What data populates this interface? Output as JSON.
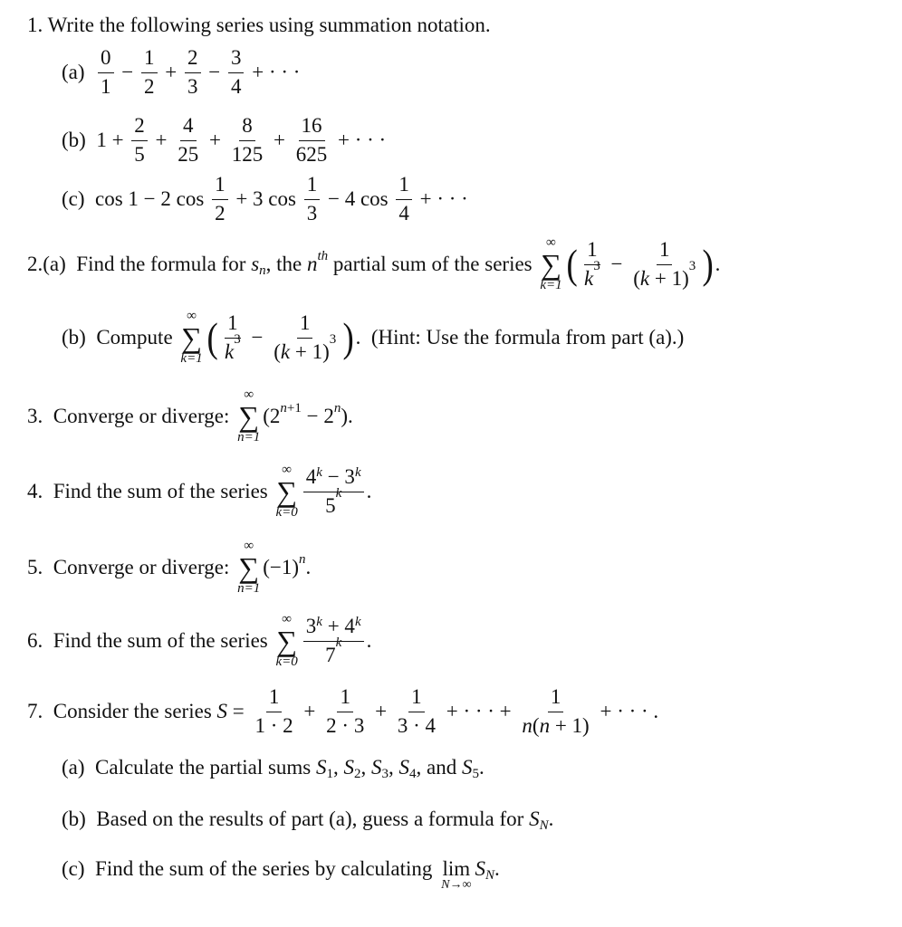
{
  "document": {
    "lines": [
      {
        "tokens": [
          [
            "t",
            "1. Write the following series using summation notation."
          ]
        ]
      },
      {
        "tokens": [
          [
            "t",
            "(a)  "
          ],
          [
            "f",
            [
              [
                "t",
                "0"
              ]
            ],
            [
              [
                "t",
                "1"
              ]
            ]
          ],
          [
            "t",
            " − "
          ],
          [
            "f",
            [
              [
                "t",
                "1"
              ]
            ],
            [
              [
                "t",
                "2"
              ]
            ]
          ],
          [
            "t",
            " + "
          ],
          [
            "f",
            [
              [
                "t",
                "2"
              ]
            ],
            [
              [
                "t",
                "3"
              ]
            ]
          ],
          [
            "t",
            " − "
          ],
          [
            "f",
            [
              [
                "t",
                "3"
              ]
            ],
            [
              [
                "t",
                "4"
              ]
            ]
          ],
          [
            "t",
            " + · · ·"
          ]
        ]
      },
      {
        "tokens": [
          [
            "t",
            "(b)  1 + "
          ],
          [
            "f",
            [
              [
                "t",
                "2"
              ]
            ],
            [
              [
                "t",
                "5"
              ]
            ]
          ],
          [
            "t",
            " + "
          ],
          [
            "f",
            [
              [
                "t",
                "4"
              ]
            ],
            [
              [
                "t",
                "25"
              ]
            ]
          ],
          [
            "t",
            " + "
          ],
          [
            "f",
            [
              [
                "t",
                "8"
              ]
            ],
            [
              [
                "t",
                "125"
              ]
            ]
          ],
          [
            "t",
            " + "
          ],
          [
            "f",
            [
              [
                "t",
                "16"
              ]
            ],
            [
              [
                "t",
                "625"
              ]
            ]
          ],
          [
            "t",
            " + · · ·"
          ]
        ]
      },
      {
        "tokens": [
          [
            "t",
            "(c)  cos 1 − 2 cos "
          ],
          [
            "f",
            [
              [
                "t",
                "1"
              ]
            ],
            [
              [
                "t",
                "2"
              ]
            ]
          ],
          [
            "t",
            " + 3 cos "
          ],
          [
            "f",
            [
              [
                "t",
                "1"
              ]
            ],
            [
              [
                "t",
                "3"
              ]
            ]
          ],
          [
            "t",
            " − 4 cos "
          ],
          [
            "f",
            [
              [
                "t",
                "1"
              ]
            ],
            [
              [
                "t",
                "4"
              ]
            ]
          ],
          [
            "t",
            " + · · ·"
          ]
        ]
      },
      {
        "tokens": [
          [
            "t",
            "2.(a)  Find the formula for "
          ],
          [
            "i",
            "s"
          ],
          [
            "b",
            [
              [
                "i",
                "n"
              ]
            ]
          ],
          [
            "t",
            ", the "
          ],
          [
            "i",
            "n"
          ],
          [
            "p",
            [
              [
                "i",
                "th"
              ]
            ]
          ],
          [
            "t",
            " partial sum of the series "
          ],
          [
            "s",
            "∑",
            "∞",
            "k=1"
          ],
          [
            "L",
            "("
          ],
          [
            "f",
            [
              [
                "t",
                "1"
              ]
            ],
            [
              [
                "i",
                "k"
              ],
              [
                "p",
                [
                  [
                    "t",
                    "3"
                  ]
                ]
              ]
            ]
          ],
          [
            "t",
            " − "
          ],
          [
            "f",
            [
              [
                "t",
                "1"
              ]
            ],
            [
              [
                "t",
                "("
              ],
              [
                "i",
                "k"
              ],
              [
                "t",
                " + 1)"
              ],
              [
                "p",
                [
                  [
                    "t",
                    "3"
                  ]
                ]
              ]
            ]
          ],
          [
            "L",
            ")"
          ],
          [
            "t",
            "."
          ]
        ]
      },
      {
        "tokens": [
          [
            "t",
            "(b)  Compute "
          ],
          [
            "s",
            "∑",
            "∞",
            "k=1"
          ],
          [
            "L",
            "("
          ],
          [
            "f",
            [
              [
                "t",
                "1"
              ]
            ],
            [
              [
                "i",
                "k"
              ],
              [
                "p",
                [
                  [
                    "t",
                    "3"
                  ]
                ]
              ]
            ]
          ],
          [
            "t",
            " − "
          ],
          [
            "f",
            [
              [
                "t",
                "1"
              ]
            ],
            [
              [
                "t",
                "("
              ],
              [
                "i",
                "k"
              ],
              [
                "t",
                " + 1)"
              ],
              [
                "p",
                [
                  [
                    "t",
                    "3"
                  ]
                ]
              ]
            ]
          ],
          [
            "L",
            ")"
          ],
          [
            "t",
            ".  (Hint: Use the formula from part (a).)"
          ]
        ]
      },
      {
        "tokens": [
          [
            "t",
            "3.  Converge or diverge: "
          ],
          [
            "s",
            "∑",
            "∞",
            "n=1"
          ],
          [
            "t",
            "(2"
          ],
          [
            "p",
            [
              [
                "i",
                "n"
              ],
              [
                "t",
                "+1"
              ]
            ]
          ],
          [
            "t",
            " − 2"
          ],
          [
            "p",
            [
              [
                "i",
                "n"
              ]
            ]
          ],
          [
            "t",
            ")."
          ]
        ]
      },
      {
        "tokens": [
          [
            "t",
            "4.  Find the sum of the series "
          ],
          [
            "s",
            "∑",
            "∞",
            "k=0"
          ],
          [
            "f",
            [
              [
                "t",
                "4"
              ],
              [
                "p",
                [
                  [
                    "i",
                    "k"
                  ]
                ]
              ],
              [
                "t",
                " − 3"
              ],
              [
                "p",
                [
                  [
                    "i",
                    "k"
                  ]
                ]
              ]
            ],
            [
              [
                "t",
                "5"
              ],
              [
                "p",
                [
                  [
                    "i",
                    "k"
                  ]
                ]
              ]
            ]
          ],
          [
            "t",
            "."
          ]
        ]
      },
      {
        "tokens": [
          [
            "t",
            "5.  Converge or diverge: "
          ],
          [
            "s",
            "∑",
            "∞",
            "n=1"
          ],
          [
            "t",
            "(−1)"
          ],
          [
            "p",
            [
              [
                "i",
                "n"
              ]
            ]
          ],
          [
            "t",
            "."
          ]
        ]
      },
      {
        "tokens": [
          [
            "t",
            "6.  Find the sum of the series "
          ],
          [
            "s",
            "∑",
            "∞",
            "k=0"
          ],
          [
            "f",
            [
              [
                "t",
                "3"
              ],
              [
                "p",
                [
                  [
                    "i",
                    "k"
                  ]
                ]
              ],
              [
                "t",
                " + 4"
              ],
              [
                "p",
                [
                  [
                    "i",
                    "k"
                  ]
                ]
              ]
            ],
            [
              [
                "t",
                "7"
              ],
              [
                "p",
                [
                  [
                    "i",
                    "k"
                  ]
                ]
              ]
            ]
          ],
          [
            "t",
            "."
          ]
        ]
      },
      {
        "tokens": [
          [
            "t",
            "7.  Consider the series "
          ],
          [
            "i",
            "S"
          ],
          [
            "t",
            " = "
          ],
          [
            "f",
            [
              [
                "t",
                "1"
              ]
            ],
            [
              [
                "t",
                "1 · 2"
              ]
            ]
          ],
          [
            "t",
            " + "
          ],
          [
            "f",
            [
              [
                "t",
                "1"
              ]
            ],
            [
              [
                "t",
                "2 · 3"
              ]
            ]
          ],
          [
            "t",
            " + "
          ],
          [
            "f",
            [
              [
                "t",
                "1"
              ]
            ],
            [
              [
                "t",
                "3 · 4"
              ]
            ]
          ],
          [
            "t",
            " + · · · + "
          ],
          [
            "f",
            [
              [
                "t",
                "1"
              ]
            ],
            [
              [
                "i",
                "n"
              ],
              [
                "t",
                "("
              ],
              [
                "i",
                "n"
              ],
              [
                "t",
                " + 1)"
              ]
            ]
          ],
          [
            "t",
            " + · · · ."
          ]
        ]
      },
      {
        "tokens": [
          [
            "t",
            "(a)  Calculate the partial sums "
          ],
          [
            "i",
            "S"
          ],
          [
            "b",
            [
              [
                "t",
                "1"
              ]
            ]
          ],
          [
            "t",
            ", "
          ],
          [
            "i",
            "S"
          ],
          [
            "b",
            [
              [
                "t",
                "2"
              ]
            ]
          ],
          [
            "t",
            ", "
          ],
          [
            "i",
            "S"
          ],
          [
            "b",
            [
              [
                "t",
                "3"
              ]
            ]
          ],
          [
            "t",
            ", "
          ],
          [
            "i",
            "S"
          ],
          [
            "b",
            [
              [
                "t",
                "4"
              ]
            ]
          ],
          [
            "t",
            ", and "
          ],
          [
            "i",
            "S"
          ],
          [
            "b",
            [
              [
                "t",
                "5"
              ]
            ]
          ],
          [
            "t",
            "."
          ]
        ]
      },
      {
        "tokens": [
          [
            "t",
            "(b)  Based on the results of part (a), guess a formula for "
          ],
          [
            "i",
            "S"
          ],
          [
            "b",
            [
              [
                "i",
                "N"
              ]
            ]
          ],
          [
            "t",
            "."
          ]
        ]
      },
      {
        "tokens": [
          [
            "t",
            "(c)  Find the sum of the series by calculating "
          ],
          [
            "l",
            "lim",
            "N→∞"
          ],
          [
            "i",
            "S"
          ],
          [
            "b",
            [
              [
                "i",
                "N"
              ]
            ]
          ],
          [
            "t",
            "."
          ]
        ]
      }
    ]
  }
}
